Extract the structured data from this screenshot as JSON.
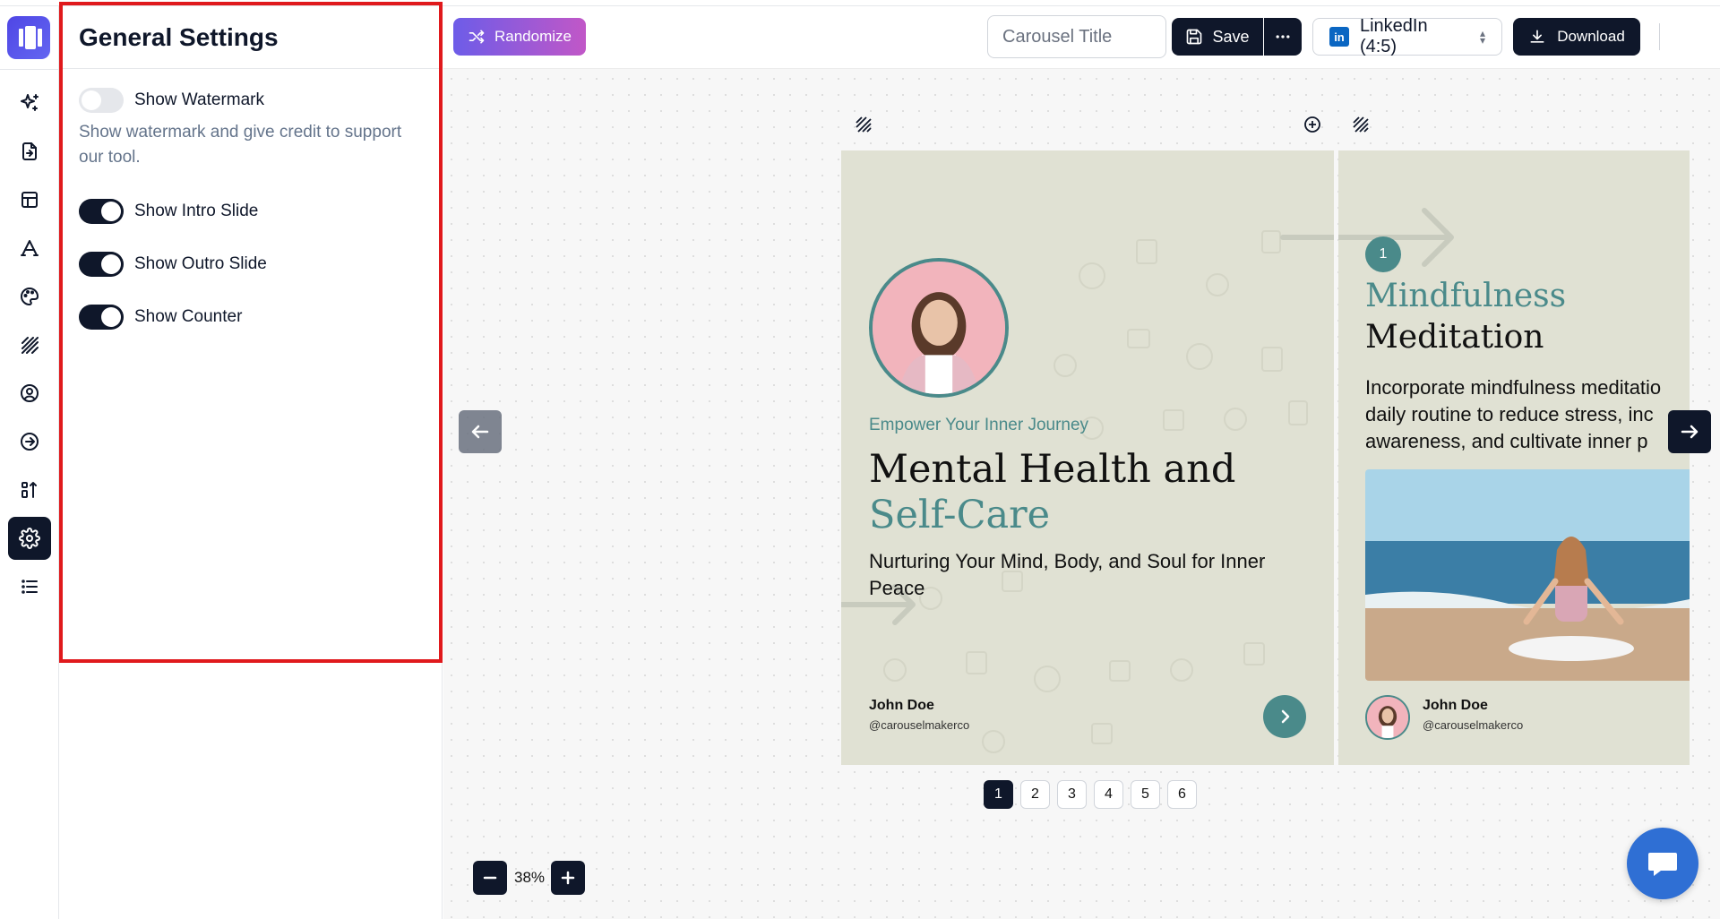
{
  "settings_panel": {
    "title": "General Settings",
    "items": [
      {
        "label": "Show Watermark",
        "on": false
      },
      {
        "label": "Show Intro Slide",
        "on": true
      },
      {
        "label": "Show Outro Slide",
        "on": true
      },
      {
        "label": "Show Counter",
        "on": true
      }
    ],
    "watermark_description": "Show watermark and give credit to support our tool."
  },
  "toolbar": {
    "randomize_label": "Randomize",
    "title_placeholder": "Carousel Title",
    "save_label": "Save",
    "format_label": "LinkedIn (4:5)",
    "linkedin_badge": "in",
    "download_label": "Download"
  },
  "slides": {
    "intro": {
      "tagline": "Empower Your Inner Journey",
      "title_line1": "Mental Health and",
      "title_accent": "Self-Care",
      "subtitle": "Nurturing Your Mind, Body, and Soul for Inner Peace",
      "author_name": "John Doe",
      "author_handle": "@carouselmakerco"
    },
    "slide2": {
      "number": "1",
      "title_line1": "Mindfulness",
      "title_line2": "Meditation",
      "body_lines": [
        "Incorporate mindfulness meditatio",
        "daily routine to reduce stress, inc",
        "awareness, and cultivate inner p"
      ],
      "author_name": "John Doe",
      "author_handle": "@carouselmakerco"
    }
  },
  "pager": {
    "pages": [
      "1",
      "2",
      "3",
      "4",
      "5",
      "6"
    ],
    "current": "1"
  },
  "zoom": {
    "value": "38%"
  },
  "colors": {
    "accent": "#4a8a8a",
    "dark": "#0f172a",
    "slide_bg": "#e0e1d3",
    "highlight": "#e0191c",
    "chat": "#2f6fd4"
  },
  "icons": {
    "rail": [
      "sparkles-icon",
      "file-import-icon",
      "layout-icon",
      "font-icon",
      "palette-icon",
      "pattern-icon",
      "user-circle-icon",
      "arrow-circle-icon",
      "sort-icon",
      "gear-icon",
      "list-icon"
    ]
  }
}
